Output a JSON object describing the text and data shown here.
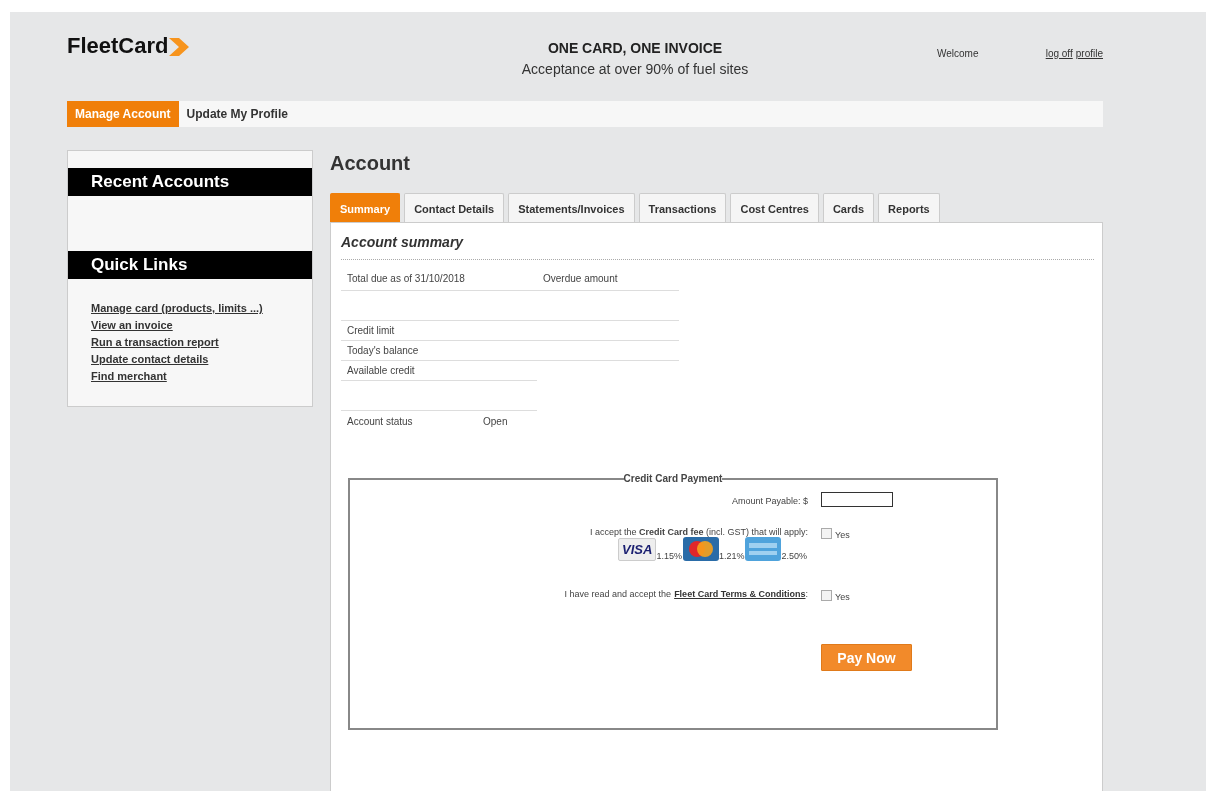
{
  "header": {
    "logo": "FleetCard",
    "tagline": "ONE CARD, ONE INVOICE",
    "subtitle": "Acceptance at over 90% of fuel sites",
    "welcome": "Welcome",
    "links": [
      "log off",
      "profile"
    ]
  },
  "nav": [
    {
      "label": "Manage Account",
      "selected": true
    },
    {
      "label": "Update My Profile",
      "selected": false
    }
  ],
  "sidebar": {
    "recent_title": "Recent Accounts",
    "quick_title": "Quick Links",
    "links": [
      "Manage card (products, limits ...)",
      "View an invoice",
      "Run a transaction report",
      "Update contact details",
      "Find merchant"
    ]
  },
  "page_title": "Account",
  "tabs": [
    {
      "label": "Summary",
      "selected": true
    },
    {
      "label": "Contact Details",
      "selected": false
    },
    {
      "label": "Statements/Invoices",
      "selected": false
    },
    {
      "label": "Transactions",
      "selected": false
    },
    {
      "label": "Cost Centres",
      "selected": false
    },
    {
      "label": "Cards",
      "selected": false
    },
    {
      "label": "Reports",
      "selected": false
    }
  ],
  "summary": {
    "title": "Account summary",
    "total_due": "Total due as of 31/10/2018",
    "overdue": "Overdue amount",
    "rows": [
      {
        "label": "Credit limit"
      },
      {
        "label": "Today's balance"
      },
      {
        "label": "Available credit"
      }
    ],
    "status_label": "Account status",
    "status_value": "Open"
  },
  "payment": {
    "legend": "Credit Card Payment",
    "amount_label": "Amount Payable: $",
    "fee_text": "I accept the **Credit Card fee** (incl. GST) that will apply:",
    "fee_checked": false,
    "fee_yes": "Yes",
    "cards": [
      {
        "kind": "visa",
        "label": "VISA",
        "rate": "1.15%"
      },
      {
        "kind": "mastercard",
        "rate": "1.21%"
      },
      {
        "kind": "amex",
        "rate": "2.50%"
      }
    ],
    "terms_prefix": "I have read and accept the",
    "terms_link": "Fleet Card Terms & Conditions",
    "terms_suffix": ":",
    "terms_checked": false,
    "terms_yes": "Yes",
    "button": "Pay Now"
  }
}
